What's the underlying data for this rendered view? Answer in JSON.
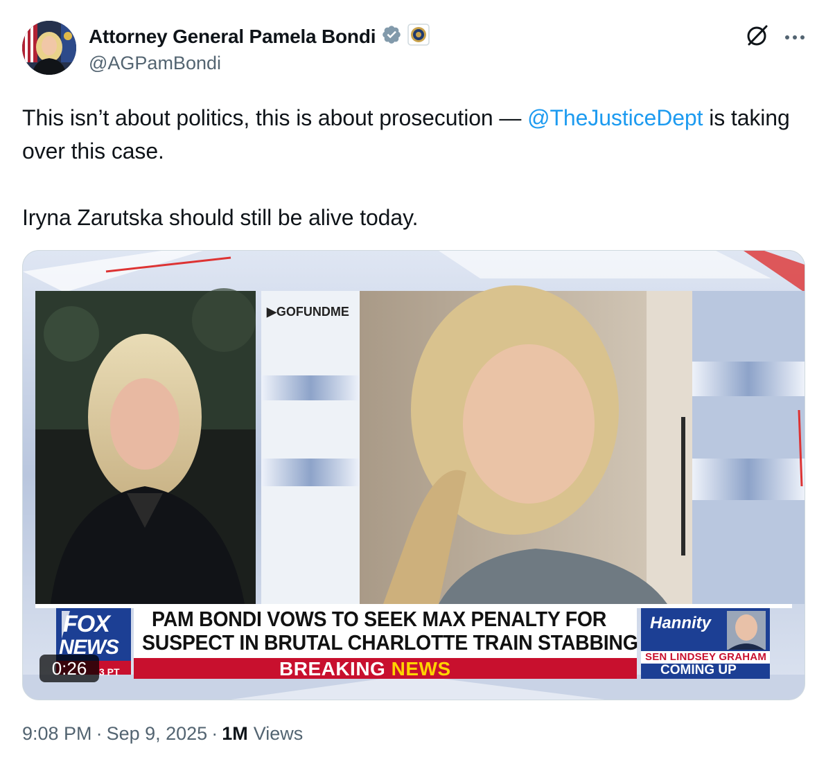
{
  "author": {
    "display_name": "Attorney General Pamela Bondi",
    "handle": "@AGPamBondi",
    "verified_badge_icon": "verified-badge-icon",
    "affiliate_icon": "doj-seal-icon",
    "badge_color": "#829aab"
  },
  "actions": {
    "grok_icon": "grok-icon",
    "more_icon": "more-dots-icon"
  },
  "tweet": {
    "line1_prefix": "This isn’t about politics, this is about prosecution — ",
    "mention": "@TheJusticeDept",
    "line1_suffix": " is taking over this case.",
    "line2": "Iryna Zarutska should still be alive today."
  },
  "media": {
    "type": "video",
    "duration": "0:26",
    "source_tag": "▶GOFUNDME",
    "headline_line1": "PAM BONDI VOWS TO SEEK MAX PENALTY FOR",
    "headline_line2": "SUSPECT IN BRUTAL CHARLOTTE TRAIN STABBING",
    "breaking_word": "BREAKING ",
    "news_word": "NEWS",
    "network_line1": "FOX",
    "network_line2": "NEWS",
    "time_fragment": "3 PT",
    "show_name": "Hannity",
    "upcoming_guest": "SEN LINDSEY GRAHAM",
    "coming_up": "COMING UP"
  },
  "meta": {
    "time": "9:08 PM",
    "date": "Sep 9, 2025",
    "views_count": "1M",
    "views_label": "Views"
  },
  "colors": {
    "link": "#1d9bf0",
    "secondary_text": "#536471",
    "breaking_red": "#c8102e",
    "news_yellow": "#ffd400",
    "fox_blue": "#1c3f94"
  }
}
